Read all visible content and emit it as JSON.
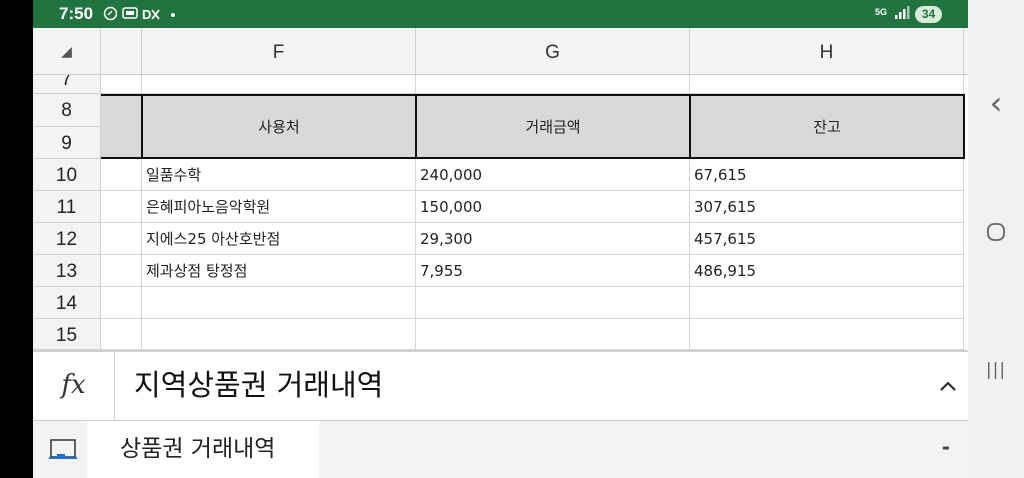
{
  "status_bar": {
    "time": "7:50",
    "left_icons": [
      "sync-icon",
      "message-icon",
      "vpn-off-icon",
      "dot-icon"
    ],
    "network": "5G",
    "battery": "34"
  },
  "sheet": {
    "select_all_glyph": "◢",
    "columns": [
      "F",
      "G",
      "H"
    ],
    "row_numbers": [
      "7",
      "8",
      "9",
      "10",
      "11",
      "12",
      "13",
      "14",
      "15"
    ],
    "header_row": [
      "사용처",
      "거래금액",
      "잔고"
    ],
    "data_rows": [
      [
        "일품수학",
        "240,000",
        "67,615"
      ],
      [
        "은혜피아노음악학원",
        "150,000",
        "307,615"
      ],
      [
        "지에스25 아산호반점",
        "29,300",
        "457,615"
      ],
      [
        "제과상점 탕정점",
        "7,955",
        "486,915"
      ]
    ]
  },
  "formula_bar": {
    "fx_label": "fx",
    "text": "지역상품권 거래내역"
  },
  "sheet_tabs": {
    "active_tab": "상품권 거래내역",
    "dash": "-"
  },
  "nav": {
    "back_glyph": "‹",
    "home_glyph": "○",
    "recents_glyph": "|||"
  }
}
